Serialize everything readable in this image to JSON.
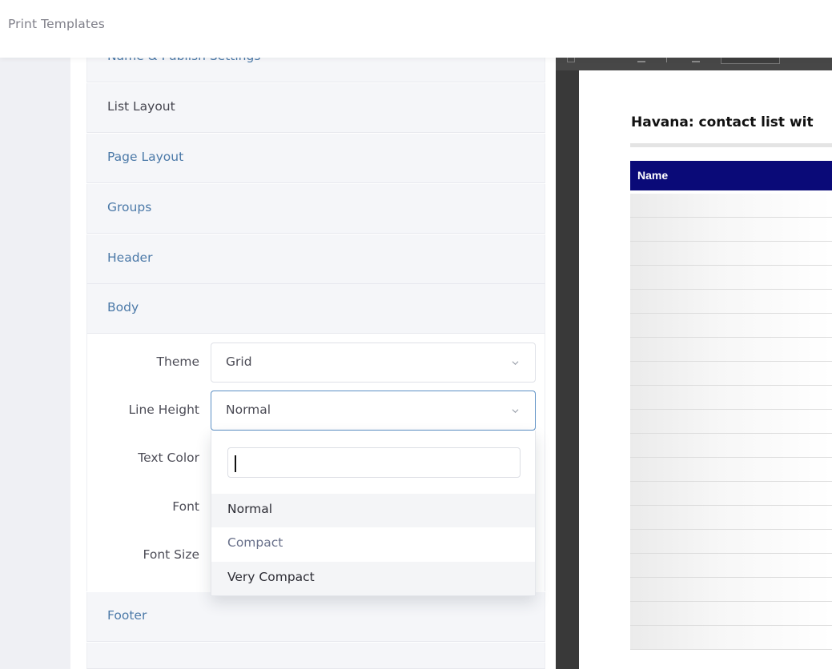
{
  "app": {
    "title": "Print Templates"
  },
  "accordion": {
    "sections": [
      {
        "label": "Name & Publish Settings"
      },
      {
        "label": "List Layout"
      },
      {
        "label": "Page Layout"
      },
      {
        "label": "Groups"
      },
      {
        "label": "Header"
      },
      {
        "label": "Body"
      },
      {
        "label": "Footer"
      }
    ]
  },
  "body_settings": {
    "theme": {
      "label": "Theme",
      "value": "Grid"
    },
    "line_height": {
      "label": "Line Height",
      "value": "Normal",
      "search_value": "",
      "options": [
        "Normal",
        "Compact",
        "Very Compact"
      ]
    },
    "text_color": {
      "label": "Text Color"
    },
    "font": {
      "label": "Font"
    },
    "font_size": {
      "label": "Font Size"
    }
  },
  "preview": {
    "document_title": "Havana: contact list wit",
    "table_header": "Name",
    "header_color": "#0a0a78"
  },
  "icons": {
    "theme_select": "chevron-down-icon",
    "line_height_select": "chevron-down-icon"
  }
}
